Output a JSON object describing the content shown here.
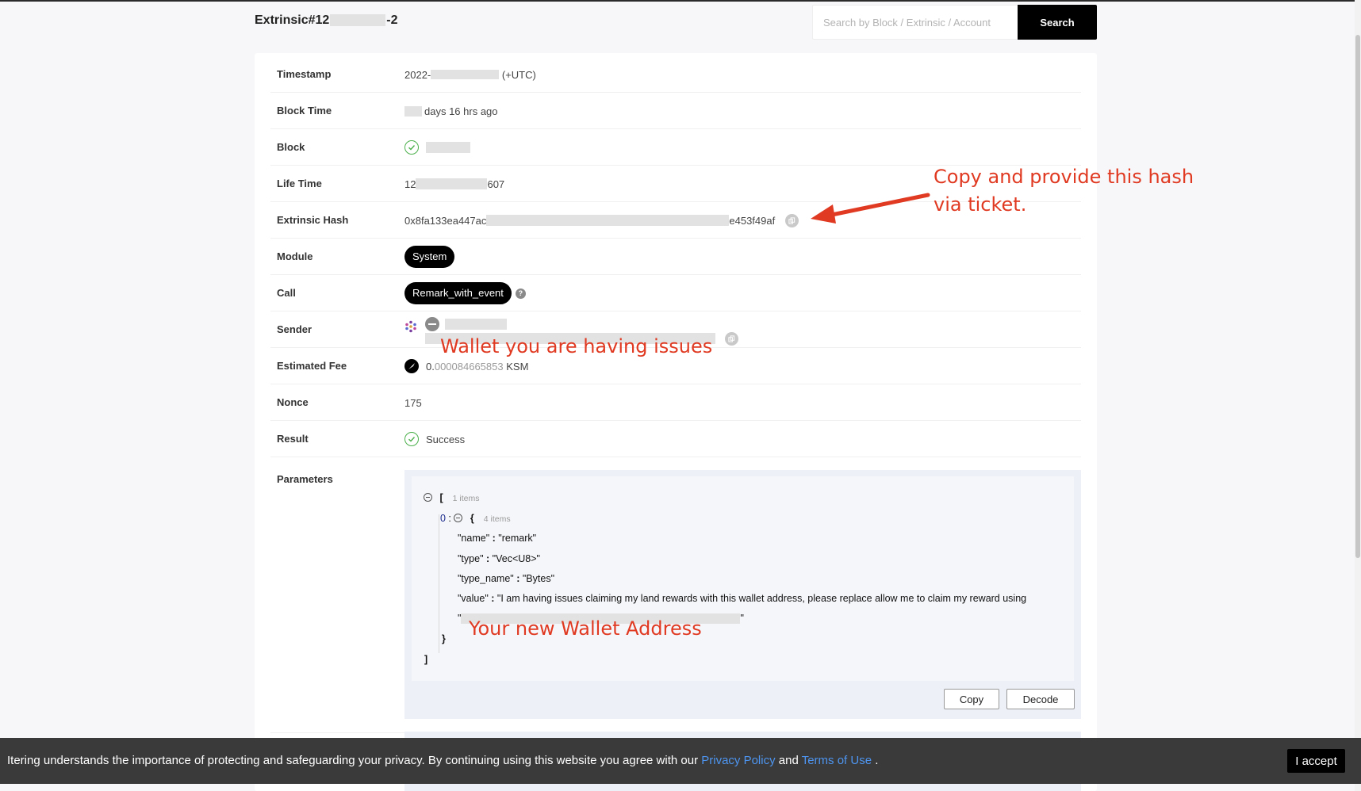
{
  "page": {
    "title_prefix": "Extrinsic#12",
    "title_suffix": "-2"
  },
  "search": {
    "placeholder": "Search by Block / Extrinsic / Account",
    "button_label": "Search"
  },
  "details": {
    "timestamp": {
      "label": "Timestamp",
      "prefix": "2022-",
      "suffix": "(+UTC)"
    },
    "block_time": {
      "label": "Block Time",
      "text": "days 16 hrs ago"
    },
    "block": {
      "label": "Block"
    },
    "life_time": {
      "label": "Life Time",
      "prefix": "12",
      "suffix": "607"
    },
    "extrinsic_hash": {
      "label": "Extrinsic Hash",
      "prefix": "0x8fa133ea447ac",
      "suffix": "e453f49af"
    },
    "module": {
      "label": "Module",
      "value": "System"
    },
    "call": {
      "label": "Call",
      "value": "Remark_with_event",
      "help_glyph": "?"
    },
    "sender": {
      "label": "Sender"
    },
    "estimated_fee": {
      "label": "Estimated Fee",
      "integer": "0.",
      "decimals": "000084665853",
      "unit": "KSM"
    },
    "nonce": {
      "label": "Nonce",
      "value": "175"
    },
    "result": {
      "label": "Result",
      "value": "Success"
    },
    "parameters": {
      "label": "Parameters"
    }
  },
  "params": {
    "open_bracket": "[",
    "close_bracket": "]",
    "root_count": "1 items",
    "item_index": "0",
    "item_open": "{",
    "item_close": "}",
    "item_count": "4 items",
    "fields": [
      {
        "key": "\"name\"",
        "value": "\"remark\""
      },
      {
        "key": "\"type\"",
        "value": "\"Vec<U8>\""
      },
      {
        "key": "\"type_name\"",
        "value": "\"Bytes\""
      },
      {
        "key": "\"value\"",
        "value": "\"I am having issues claiming my land rewards with this wallet address, please replace allow me to claim my reward using"
      }
    ],
    "continuation_open": "\"",
    "continuation_close": "\"",
    "copy_label": "Copy",
    "decode_label": "Decode"
  },
  "annotations": {
    "hash_note_line1": "Copy and provide this hash",
    "hash_note_line2": "via ticket.",
    "wallet_note": "Wallet you are having issues",
    "new_wallet_note": "Your new Wallet Address"
  },
  "cookie": {
    "text_before": "Itering understands the importance of protecting and safeguarding your privacy. By continuing using this website you agree with our ",
    "privacy_link": "Privacy Policy",
    "and_text": " and ",
    "terms_link": "Terms of Use",
    "text_after": " .",
    "accept_label": "I accept"
  },
  "colors": {
    "annotation": "#e03a22",
    "link": "#3e8ef7",
    "success": "#4cb04c"
  }
}
